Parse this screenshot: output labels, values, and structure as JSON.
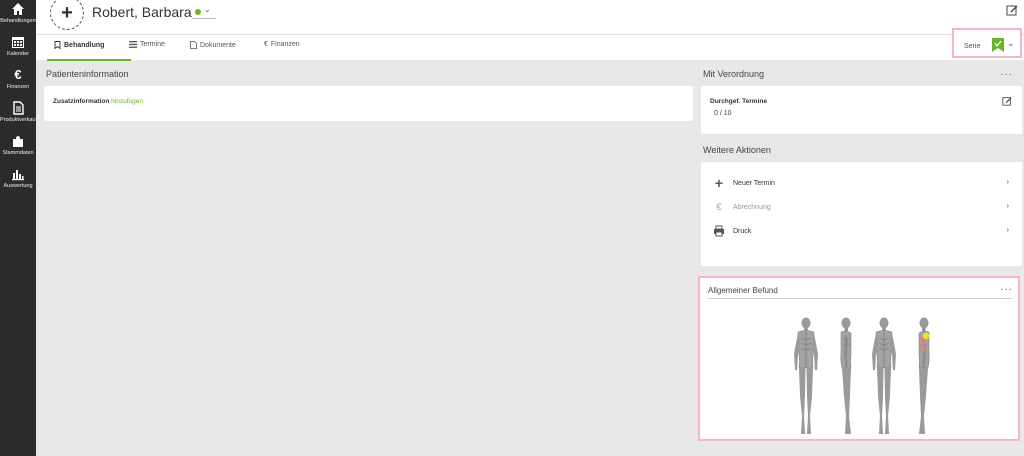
{
  "sidebar": {
    "items": [
      {
        "label": "Behandlungen",
        "icon": "home-icon"
      },
      {
        "label": "Kalender",
        "icon": "calendar-icon"
      },
      {
        "label": "Finanzen",
        "icon": "euro-icon"
      },
      {
        "label": "Produktverkauf",
        "icon": "document-icon"
      },
      {
        "label": "Stammdaten",
        "icon": "puzzle-icon"
      },
      {
        "label": "Auswertung",
        "icon": "bar-chart-icon"
      }
    ]
  },
  "header": {
    "patient_name": "Robert, Barbara",
    "status_color": "#6ab42d"
  },
  "tabs": [
    {
      "label": "Behandlung",
      "icon": "bookmark-icon",
      "active": true
    },
    {
      "label": "Termine",
      "icon": "list-icon",
      "active": false
    },
    {
      "label": "Dokumente",
      "icon": "file-icon",
      "active": false
    },
    {
      "label": "Finanzen",
      "icon": "euro-icon",
      "active": false
    }
  ],
  "serie": {
    "label": "Serie",
    "flag_color": "#6ab42d"
  },
  "patient_info": {
    "title": "Patienteninformation",
    "zusatz_label": "Zusatzinformation",
    "zusatz_link": "hinzufügen"
  },
  "verordnung": {
    "title": "Mit Verordnung",
    "termine_label": "Durchgef. Termine",
    "termine_value": "0 / 10"
  },
  "weitere_aktionen": {
    "title": "Weitere Aktionen",
    "items": [
      {
        "label": "Neuer Termin",
        "icon": "plus-icon",
        "enabled": true
      },
      {
        "label": "Abrechnung",
        "icon": "euro-icon",
        "enabled": false
      },
      {
        "label": "Druck",
        "icon": "printer-icon",
        "enabled": true
      }
    ]
  },
  "befund": {
    "title": "Allgemeiner Befund",
    "marker_color": "#f2e21a",
    "views": [
      "front-view",
      "left-side-view",
      "back-view",
      "right-side-view"
    ]
  },
  "colors": {
    "accent": "#6ab42d",
    "highlight_border": "#f5b5ca",
    "sidebar_bg": "#2b2b2b"
  }
}
